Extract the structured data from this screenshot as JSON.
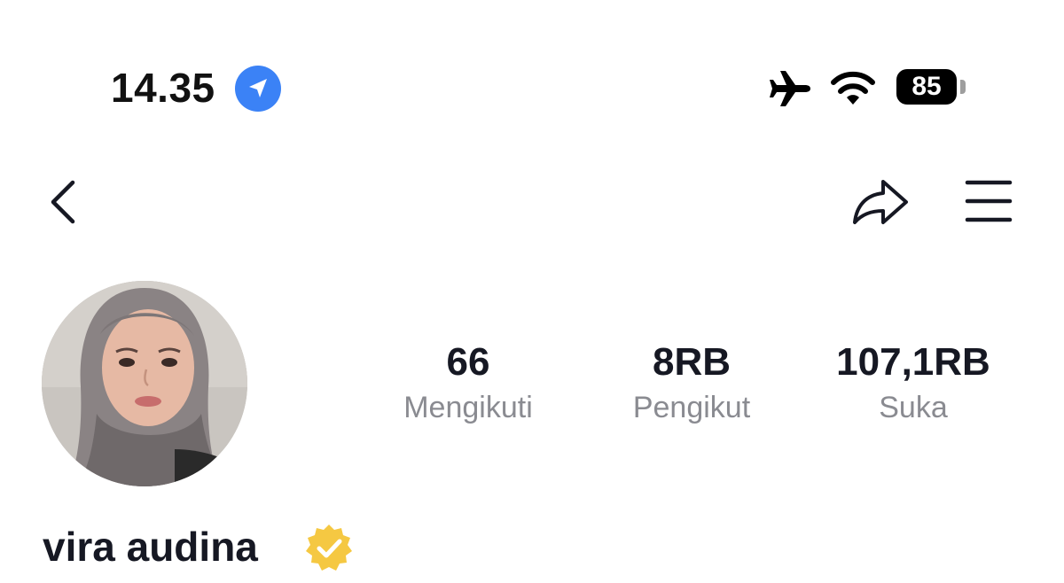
{
  "status_bar": {
    "time": "14.35",
    "battery_level": "85",
    "icons": [
      "location-arrow-icon",
      "airplane-icon",
      "wifi-icon",
      "battery-icon"
    ]
  },
  "nav": {
    "icons": [
      "back-chevron-icon",
      "share-arrow-icon",
      "hamburger-menu-icon"
    ]
  },
  "profile": {
    "name": "vira audina",
    "verified": true,
    "stats": [
      {
        "value": "66",
        "label": "Mengikuti"
      },
      {
        "value": "8RB",
        "label": "Pengikut"
      },
      {
        "value": "107,1RB",
        "label": "Suka"
      }
    ]
  },
  "colors": {
    "location_blue": "#3b82f6",
    "verified_yellow": "#f5c842",
    "label_gray": "#8a8b91",
    "text_dark": "#161823"
  }
}
